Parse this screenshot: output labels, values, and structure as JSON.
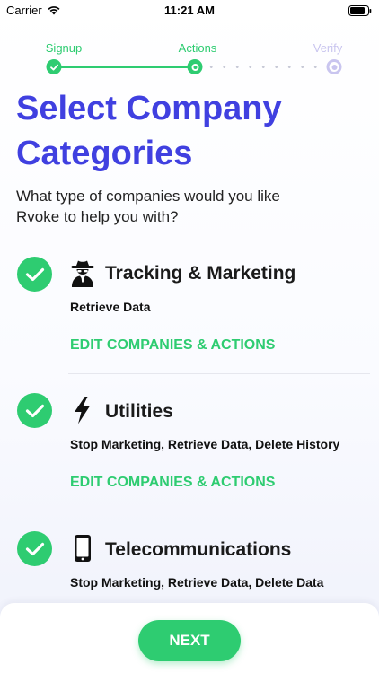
{
  "status_bar": {
    "carrier": "Carrier",
    "time": "11:21 AM",
    "icons": [
      "wifi-icon",
      "battery-icon"
    ]
  },
  "stepper": {
    "steps": [
      {
        "label": "Signup",
        "state": "complete"
      },
      {
        "label": "Actions",
        "state": "current"
      },
      {
        "label": "Verify",
        "state": "upcoming"
      }
    ],
    "colors": {
      "complete": "#2ecc71",
      "upcoming": "#c9c5ef"
    }
  },
  "header": {
    "title": "Select Company Categories",
    "subtitle": "What type of companies would you like Rvoke to help you with?"
  },
  "categories": [
    {
      "icon": "spy-icon",
      "title": "Tracking & Marketing",
      "actions": "Retrieve Data",
      "edit_label": "EDIT COMPANIES & ACTIONS",
      "selected": true
    },
    {
      "icon": "lightning-bolt-icon",
      "title": "Utilities",
      "actions": "Stop Marketing, Retrieve Data, Delete History",
      "edit_label": "EDIT COMPANIES & ACTIONS",
      "selected": true
    },
    {
      "icon": "mobile-phone-icon",
      "title": "Telecommunications",
      "actions": "Stop Marketing, Retrieve Data, Delete Data",
      "selected": true
    }
  ],
  "footer": {
    "next_label": "NEXT"
  },
  "colors": {
    "accent_green": "#2ecc71",
    "title_blue": "#4040e0"
  }
}
